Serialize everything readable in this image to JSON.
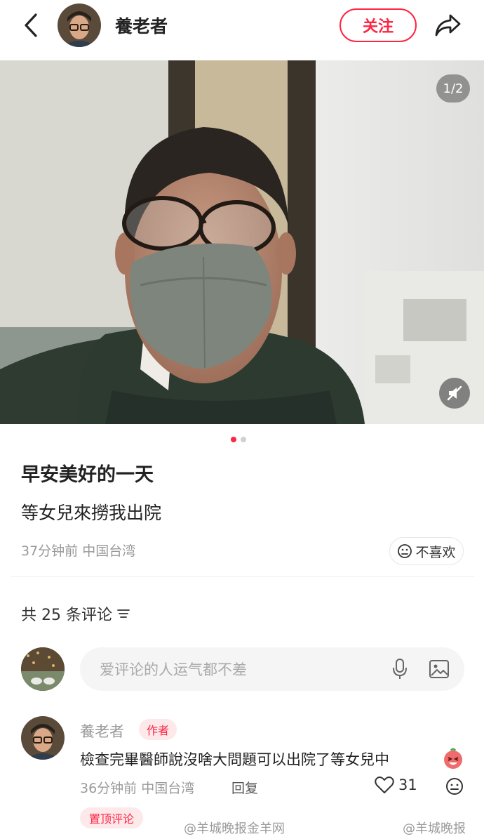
{
  "header": {
    "author_name": "養老者",
    "follow_label": "关注"
  },
  "photo": {
    "counter": "1/2",
    "page_current": 1,
    "page_total": 2
  },
  "post": {
    "title": "早安美好的一天",
    "body": "等女兒來撈我出院",
    "meta": "37分钟前 中国台湾",
    "dislike_label": "不喜欢"
  },
  "comments": {
    "count_label": "共 25 条评论",
    "input_placeholder": "爱评论的人运气都不差",
    "items": [
      {
        "name": "養老者",
        "badge": "作者",
        "text": "檢查完畢醫師說沒啥大問題可以出院了等女兒中",
        "meta": "36分钟前 中国台湾",
        "reply_label": "回复",
        "likes": "31",
        "pinned_label": "置顶评论"
      }
    ]
  },
  "watermarks": [
    "@羊城晚报金羊网",
    "@羊城晚报"
  ],
  "colors": {
    "accent": "#ff2442"
  }
}
